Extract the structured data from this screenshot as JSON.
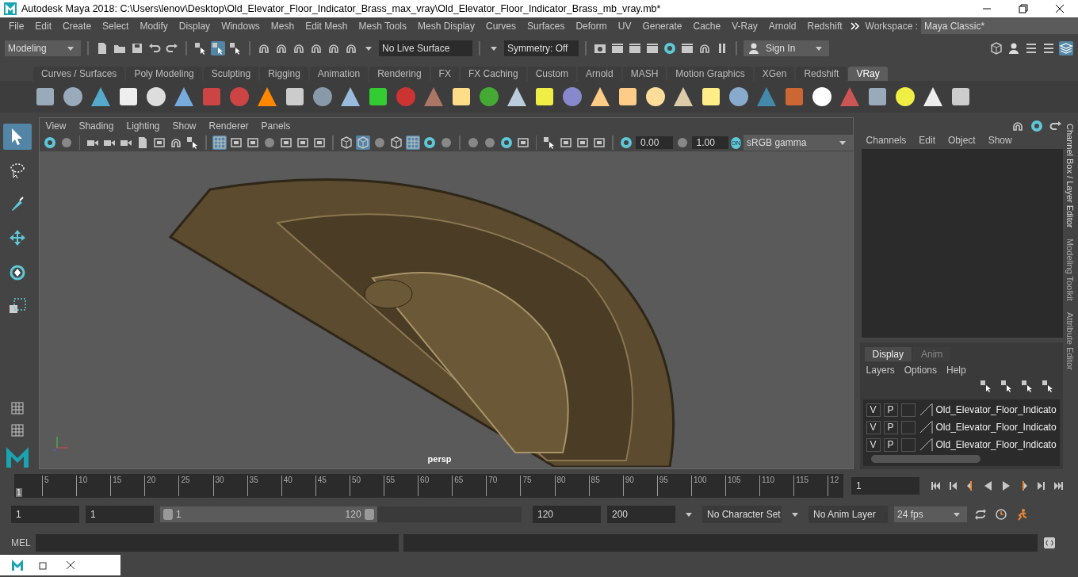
{
  "window": {
    "title": "Autodesk Maya 2018: C:\\Users\\lenov\\Desktop\\Old_Elevator_Floor_Indicator_Brass_max_vray\\Old_Elevator_Floor_Indicator_Brass_mb_vray.mb*"
  },
  "menu_bar": {
    "items": [
      "File",
      "Edit",
      "Create",
      "Select",
      "Modify",
      "Display",
      "Windows",
      "Mesh",
      "Edit Mesh",
      "Mesh Tools",
      "Mesh Display",
      "Curves",
      "Surfaces",
      "Deform",
      "UV",
      "Generate",
      "Cache",
      "V-Ray",
      "Arnold",
      "Redshift"
    ],
    "workspace_label": "Workspace :",
    "workspace": "Maya Classic*"
  },
  "status_line": {
    "menu_set": "Modeling",
    "live_surface": "No Live Surface",
    "symmetry": "Symmetry: Off",
    "sign_in": "Sign In"
  },
  "shelf": {
    "tabs": [
      {
        "label": "Curves / Surfaces",
        "selected": false
      },
      {
        "label": "Poly Modeling",
        "selected": false
      },
      {
        "label": "Sculpting",
        "selected": false
      },
      {
        "label": "Rigging",
        "selected": false
      },
      {
        "label": "Animation",
        "selected": false
      },
      {
        "label": "Rendering",
        "selected": false
      },
      {
        "label": "FX",
        "selected": false
      },
      {
        "label": "FX Caching",
        "selected": false
      },
      {
        "label": "Custom",
        "selected": false
      },
      {
        "label": "Arnold",
        "selected": false
      },
      {
        "label": "MASH",
        "selected": false
      },
      {
        "label": "Motion Graphics",
        "selected": false
      },
      {
        "label": "XGen",
        "selected": false
      },
      {
        "label": "Redshift",
        "selected": false
      },
      {
        "label": "VRay",
        "selected": true
      }
    ]
  },
  "toolbox": {
    "tools": [
      {
        "kind": "select",
        "selected": true
      },
      {
        "kind": "lasso",
        "selected": false
      },
      {
        "kind": "paint",
        "selected": false
      },
      {
        "kind": "move",
        "selected": false
      },
      {
        "kind": "rotate",
        "selected": false
      },
      {
        "kind": "scale",
        "selected": false
      }
    ]
  },
  "viewport": {
    "menu": [
      "View",
      "Shading",
      "Lighting",
      "Show",
      "Renderer",
      "Panels"
    ],
    "exposure": "0.00",
    "gamma": "1.00",
    "color_mgmt_toggle": "ON",
    "color_space": "sRGB gamma",
    "camera": "persp"
  },
  "channel_box": {
    "menu": [
      "Channels",
      "Edit",
      "Object",
      "Show"
    ]
  },
  "side_tabs": [
    "Channel Box / Layer Editor",
    "Modeling Toolkit",
    "Attribute Editor"
  ],
  "layer_editor": {
    "tabs": [
      {
        "label": "Display",
        "selected": true
      },
      {
        "label": "Anim",
        "selected": false
      }
    ],
    "menu": [
      "Layers",
      "Options",
      "Help"
    ],
    "layers": [
      {
        "visible": "V",
        "playback": "P",
        "name": "Old_Elevator_Floor_Indicato"
      },
      {
        "visible": "V",
        "playback": "P",
        "name": "Old_Elevator_Floor_Indicato"
      },
      {
        "visible": "V",
        "playback": "P",
        "name": "Old_Elevator_Floor_Indicato"
      }
    ]
  },
  "timeline": {
    "ticks": [
      "5",
      "10",
      "15",
      "20",
      "25",
      "30",
      "35",
      "40",
      "45",
      "50",
      "55",
      "60",
      "65",
      "70",
      "75",
      "80",
      "85",
      "90",
      "95",
      "100",
      "105",
      "110",
      "115",
      "12"
    ],
    "current_frame_marker": "1",
    "level": 0,
    "current_frame": "1"
  },
  "range": {
    "start": "1",
    "playback_start": "1",
    "slider_start": "1",
    "slider_end": "120",
    "level": 0.6,
    "playback_end": "120",
    "end": "200",
    "character_set": "No Character Set",
    "anim_layer": "No Anim Layer",
    "fps": "24 fps"
  },
  "command_line": {
    "label": "MEL"
  }
}
